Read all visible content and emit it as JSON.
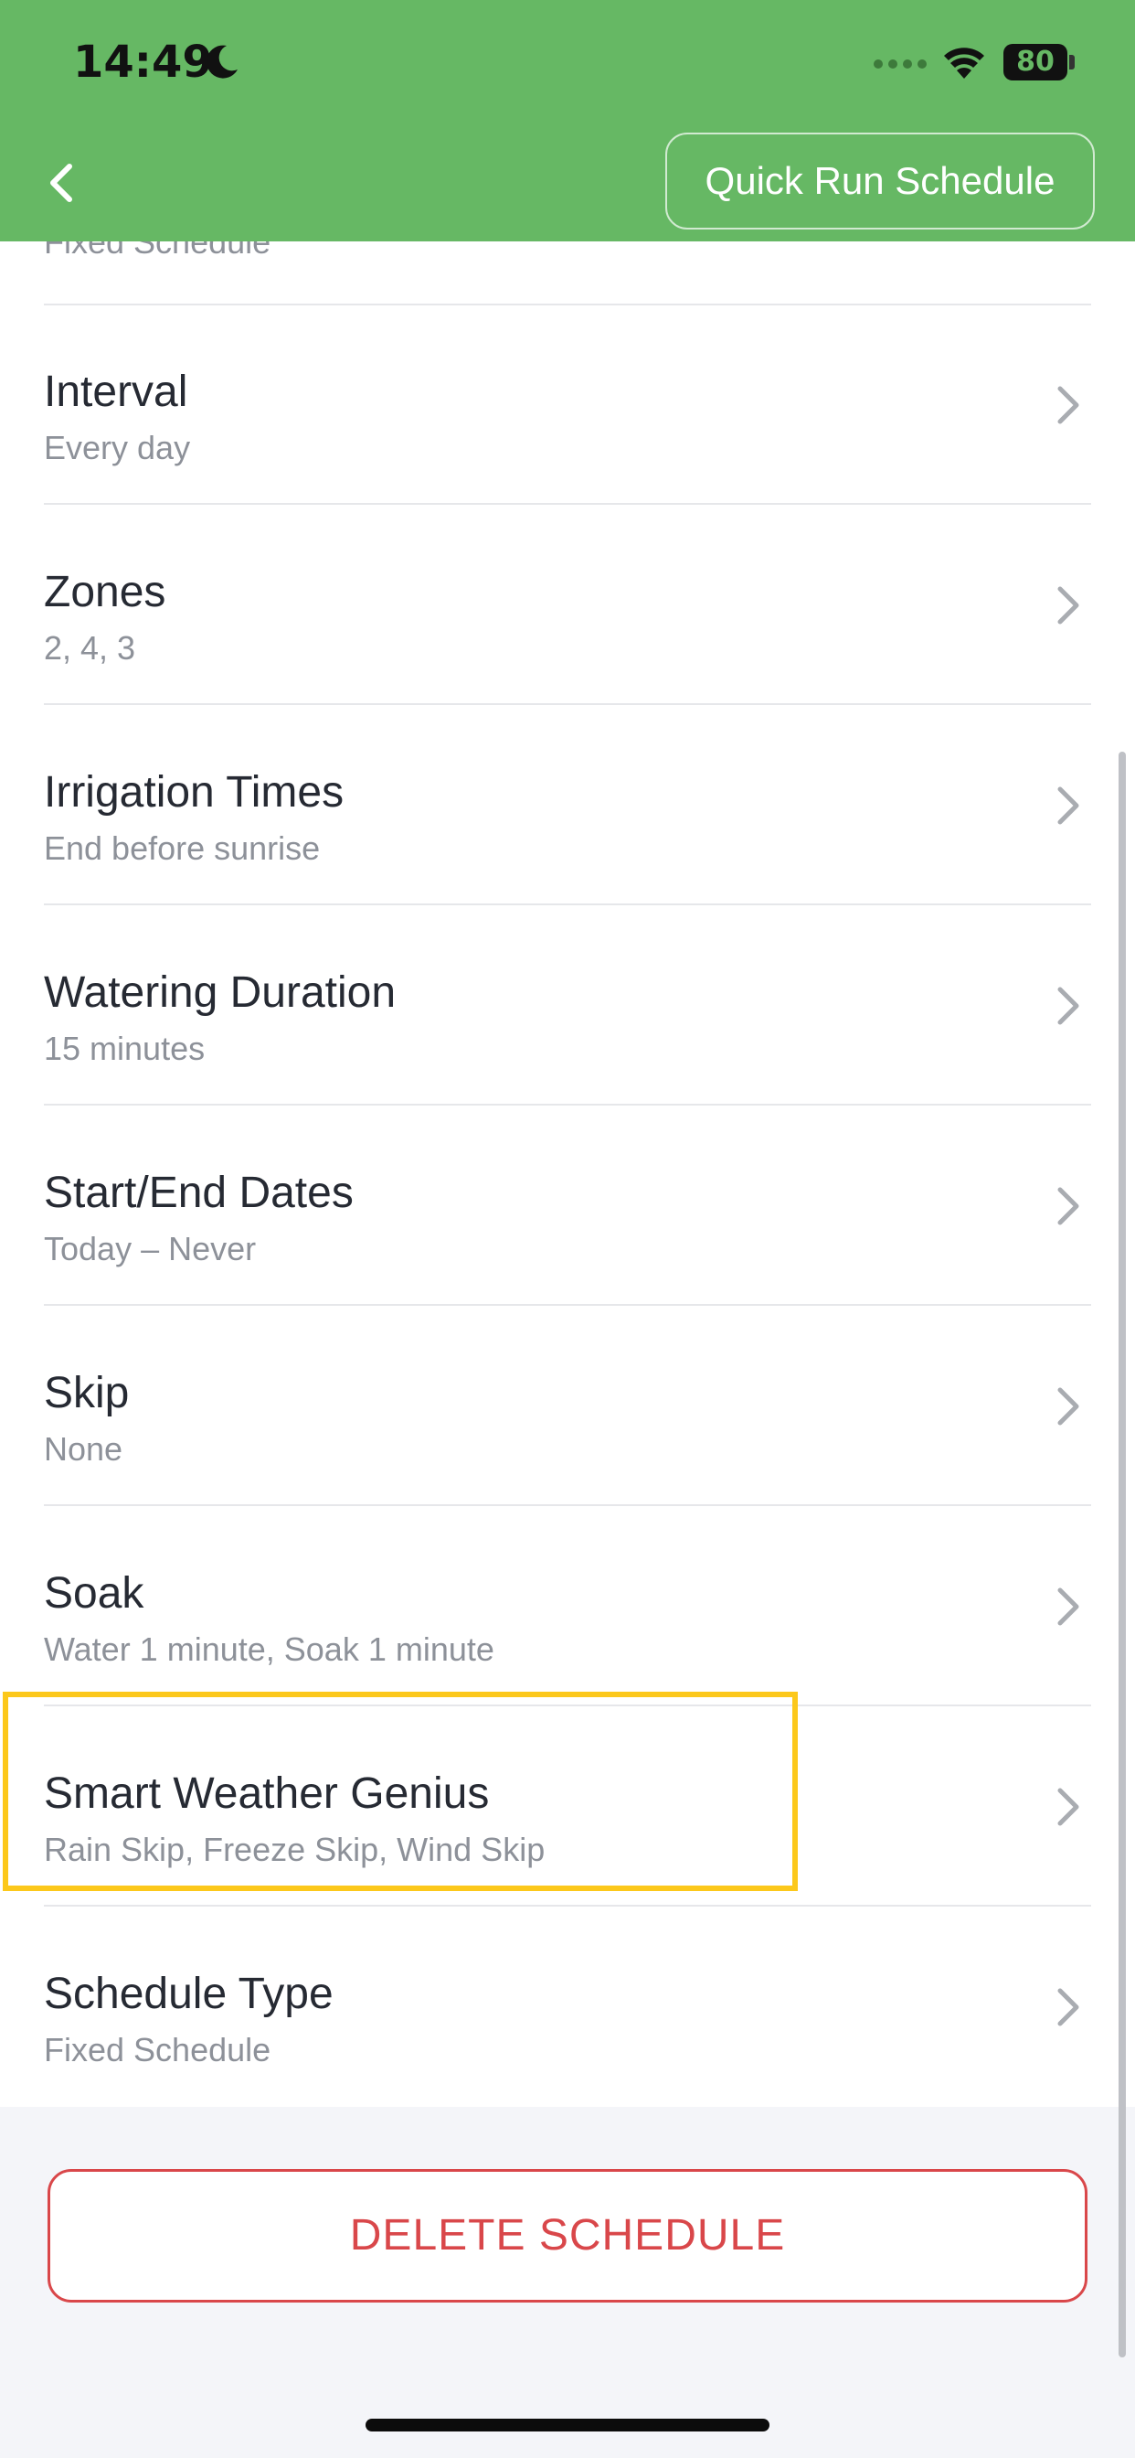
{
  "status_bar": {
    "time": "14:49",
    "battery": "80"
  },
  "header": {
    "quick_run_label": "Quick Run Schedule"
  },
  "partial_row": {
    "subtitle": "Fixed Schedule"
  },
  "rows": [
    {
      "title": "Interval",
      "subtitle": "Every day"
    },
    {
      "title": "Zones",
      "subtitle": "2, 4, 3"
    },
    {
      "title": "Irrigation Times",
      "subtitle": "End before sunrise"
    },
    {
      "title": "Watering Duration",
      "subtitle": "15 minutes"
    },
    {
      "title": "Start/End Dates",
      "subtitle": "Today – Never"
    },
    {
      "title": "Skip",
      "subtitle": "None"
    },
    {
      "title": "Soak",
      "subtitle": "Water 1 minute, Soak 1 minute"
    },
    {
      "title": "Smart Weather Genius",
      "subtitle": "Rain Skip, Freeze Skip, Wind Skip"
    },
    {
      "title": "Schedule Type",
      "subtitle": "Fixed Schedule"
    }
  ],
  "delete_label": "DELETE SCHEDULE",
  "colors": {
    "header": "#66b864",
    "delete": "#d9474a",
    "highlight": "#fcc81b"
  }
}
